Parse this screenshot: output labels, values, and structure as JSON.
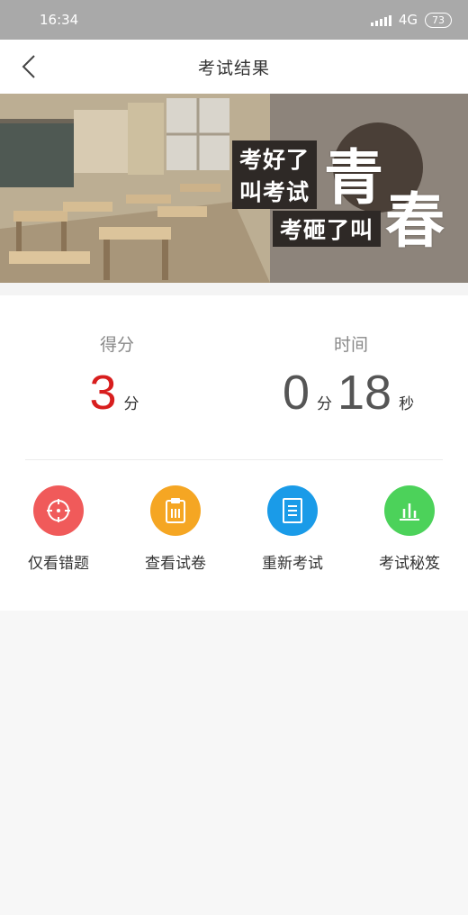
{
  "status_bar": {
    "time": "16:34",
    "network": "4G",
    "battery": "73"
  },
  "header": {
    "title": "考试结果"
  },
  "banner": {
    "line1": "考好了",
    "line2": "叫考试",
    "line3": "考砸了叫",
    "big1": "青",
    "big2": "春"
  },
  "score": {
    "label": "得分",
    "value": "3",
    "unit": "分"
  },
  "time": {
    "label": "时间",
    "minutes": "0",
    "minute_unit": "分",
    "seconds": "18",
    "second_unit": "秒"
  },
  "actions": [
    {
      "label": "仅看错题",
      "icon": "target-icon",
      "color": "#f05a5a"
    },
    {
      "label": "查看试卷",
      "icon": "clipboard-icon",
      "color": "#f5a623"
    },
    {
      "label": "重新考试",
      "icon": "document-icon",
      "color": "#1a9be8"
    },
    {
      "label": "考试秘笈",
      "icon": "bar-chart-icon",
      "color": "#4cd25a"
    }
  ]
}
